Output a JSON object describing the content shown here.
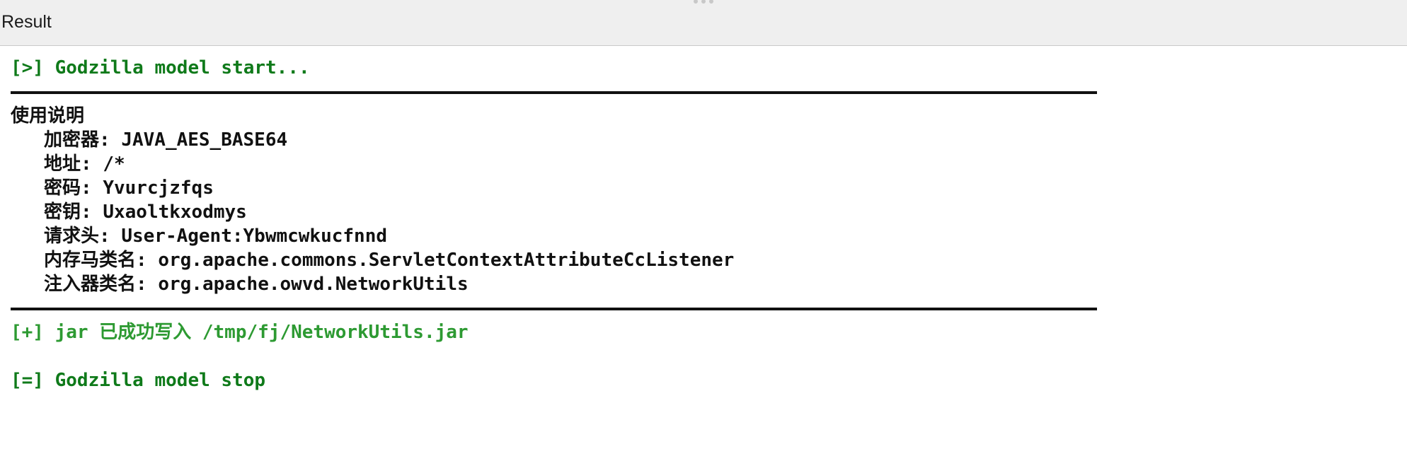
{
  "window": {
    "title": "Result"
  },
  "console": {
    "start_line": "[>] Godzilla model start...",
    "section_title": "使用说明",
    "fields": [
      {
        "label": "加密器",
        "value": "JAVA_AES_BASE64"
      },
      {
        "label": "地址",
        "value": "/*"
      },
      {
        "label": "密码",
        "value": "Yvurcjzfqs"
      },
      {
        "label": "密钥",
        "value": "Uxaoltkxodmys"
      },
      {
        "label": "请求头",
        "value": "User-Agent:Ybwmcwkucfnnd"
      },
      {
        "label": "内存马类名",
        "value": "org.apache.commons.ServletContextAttributeCcListener"
      },
      {
        "label": "注入器类名",
        "value": "org.apache.owvd.NetworkUtils"
      }
    ],
    "success_line": "[+] jar 已成功写入 /tmp/fj/NetworkUtils.jar",
    "stop_line": "[=] Godzilla model stop"
  },
  "colors": {
    "status_dark_green": "#0f7a1a",
    "status_green": "#2d9a32",
    "text": "#111111",
    "titlebar_bg": "#efefef"
  }
}
